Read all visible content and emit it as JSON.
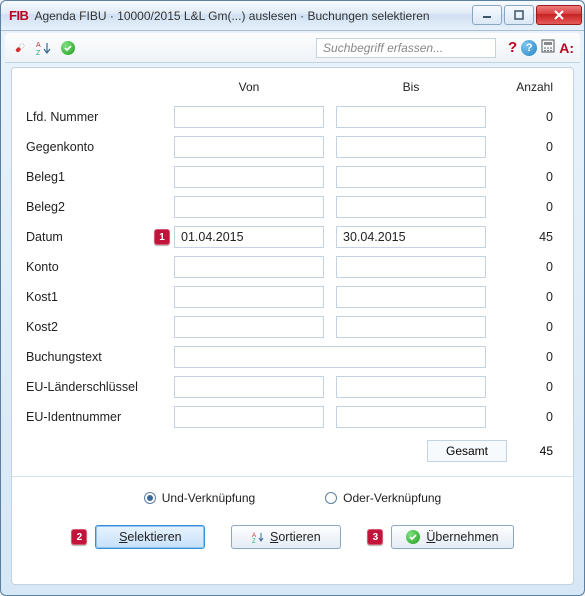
{
  "window": {
    "app_icon_text": "FIB",
    "title": "Agenda FIBU · 10000/2015 L&L Gm(...) auslesen · Buchungen selektieren"
  },
  "toolbar": {
    "search_placeholder": "Suchbegriff erfassen...",
    "red_a": "A:"
  },
  "headers": {
    "von": "Von",
    "bis": "Bis",
    "anzahl": "Anzahl"
  },
  "rows": [
    {
      "label": "Lfd. Nummer",
      "von": "",
      "bis": "",
      "count": "0",
      "wide": false,
      "callout": null
    },
    {
      "label": "Gegenkonto",
      "von": "",
      "bis": "",
      "count": "0",
      "wide": false,
      "callout": null
    },
    {
      "label": "Beleg1",
      "von": "",
      "bis": "",
      "count": "0",
      "wide": false,
      "callout": null
    },
    {
      "label": "Beleg2",
      "von": "",
      "bis": "",
      "count": "0",
      "wide": false,
      "callout": null
    },
    {
      "label": "Datum",
      "von": "01.04.2015",
      "bis": "30.04.2015",
      "count": "45",
      "wide": false,
      "callout": "1"
    },
    {
      "label": "Konto",
      "von": "",
      "bis": "",
      "count": "0",
      "wide": false,
      "callout": null
    },
    {
      "label": "Kost1",
      "von": "",
      "bis": "",
      "count": "0",
      "wide": false,
      "callout": null
    },
    {
      "label": "Kost2",
      "von": "",
      "bis": "",
      "count": "0",
      "wide": false,
      "callout": null
    },
    {
      "label": "Buchungstext",
      "von": "",
      "bis": "",
      "count": "0",
      "wide": true,
      "callout": null
    },
    {
      "label": "EU-Länderschlüssel",
      "von": "",
      "bis": "",
      "count": "0",
      "wide": false,
      "callout": null
    },
    {
      "label": "EU-Identnummer",
      "von": "",
      "bis": "",
      "count": "0",
      "wide": false,
      "callout": null
    }
  ],
  "total": {
    "label": "Gesamt",
    "value": "45"
  },
  "radios": {
    "und": "Und-Verknüpfung",
    "oder": "Oder-Verknüpfung",
    "selected": "und"
  },
  "buttons": {
    "selektieren_pre": "S",
    "selektieren_post": "elektieren",
    "sortieren_pre": "S",
    "sortieren_post": "ortieren",
    "uebernehmen_pre": "Ü",
    "uebernehmen_post": "bernehmen",
    "callout_sel": "2",
    "callout_ueb": "3"
  }
}
